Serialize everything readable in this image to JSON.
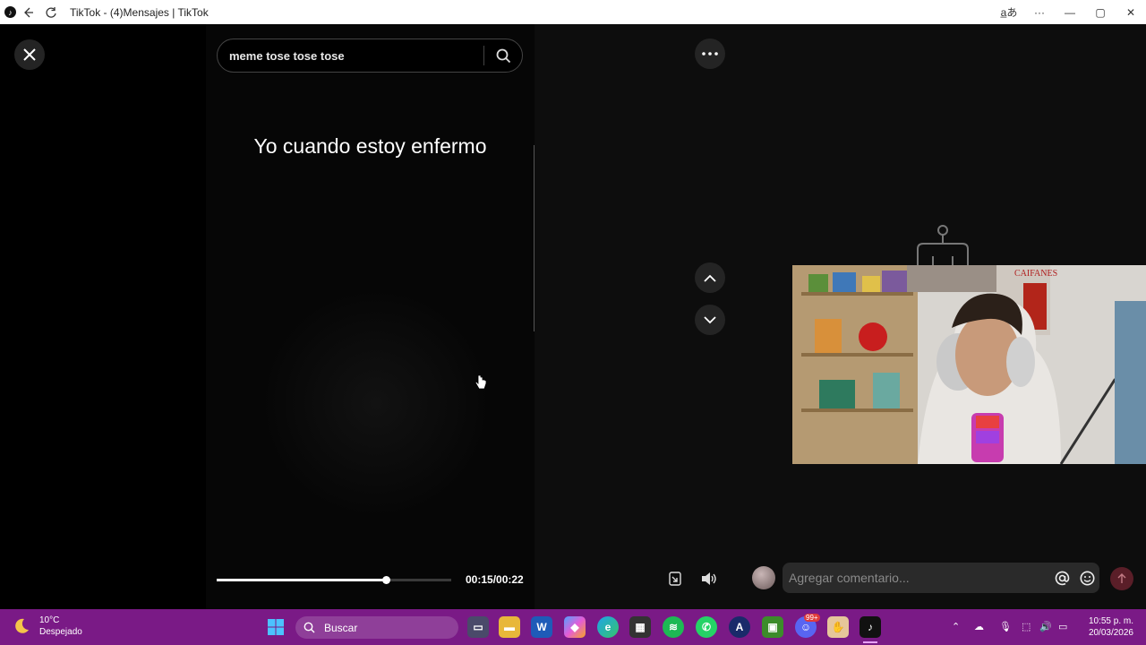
{
  "window": {
    "title": "TikTok - (4)Mensajes | TikTok",
    "translate_icon": "translate-icon",
    "controls": [
      "more-icon",
      "minimize-icon",
      "maximize-icon",
      "close-icon"
    ]
  },
  "search": {
    "query": "meme tose tose tose",
    "icon": "search-icon"
  },
  "video": {
    "caption": "Yo cuando estoy enfermo",
    "time": "00:15/00:22",
    "progress": 0.72
  },
  "comment": {
    "placeholder": "Agregar comentario..."
  },
  "webcam": {
    "sign_text": "CAIFANES"
  },
  "taskbar": {
    "weather_temp": "10°C",
    "weather_desc": "Despejado",
    "search_label": "Buscar",
    "badge": "99+",
    "time": "10:55 p. m.",
    "date": "20/03/2026"
  },
  "colors": {
    "taskbar": "#7a1a86",
    "background": "#000000",
    "send_button": "#5a1e28"
  }
}
